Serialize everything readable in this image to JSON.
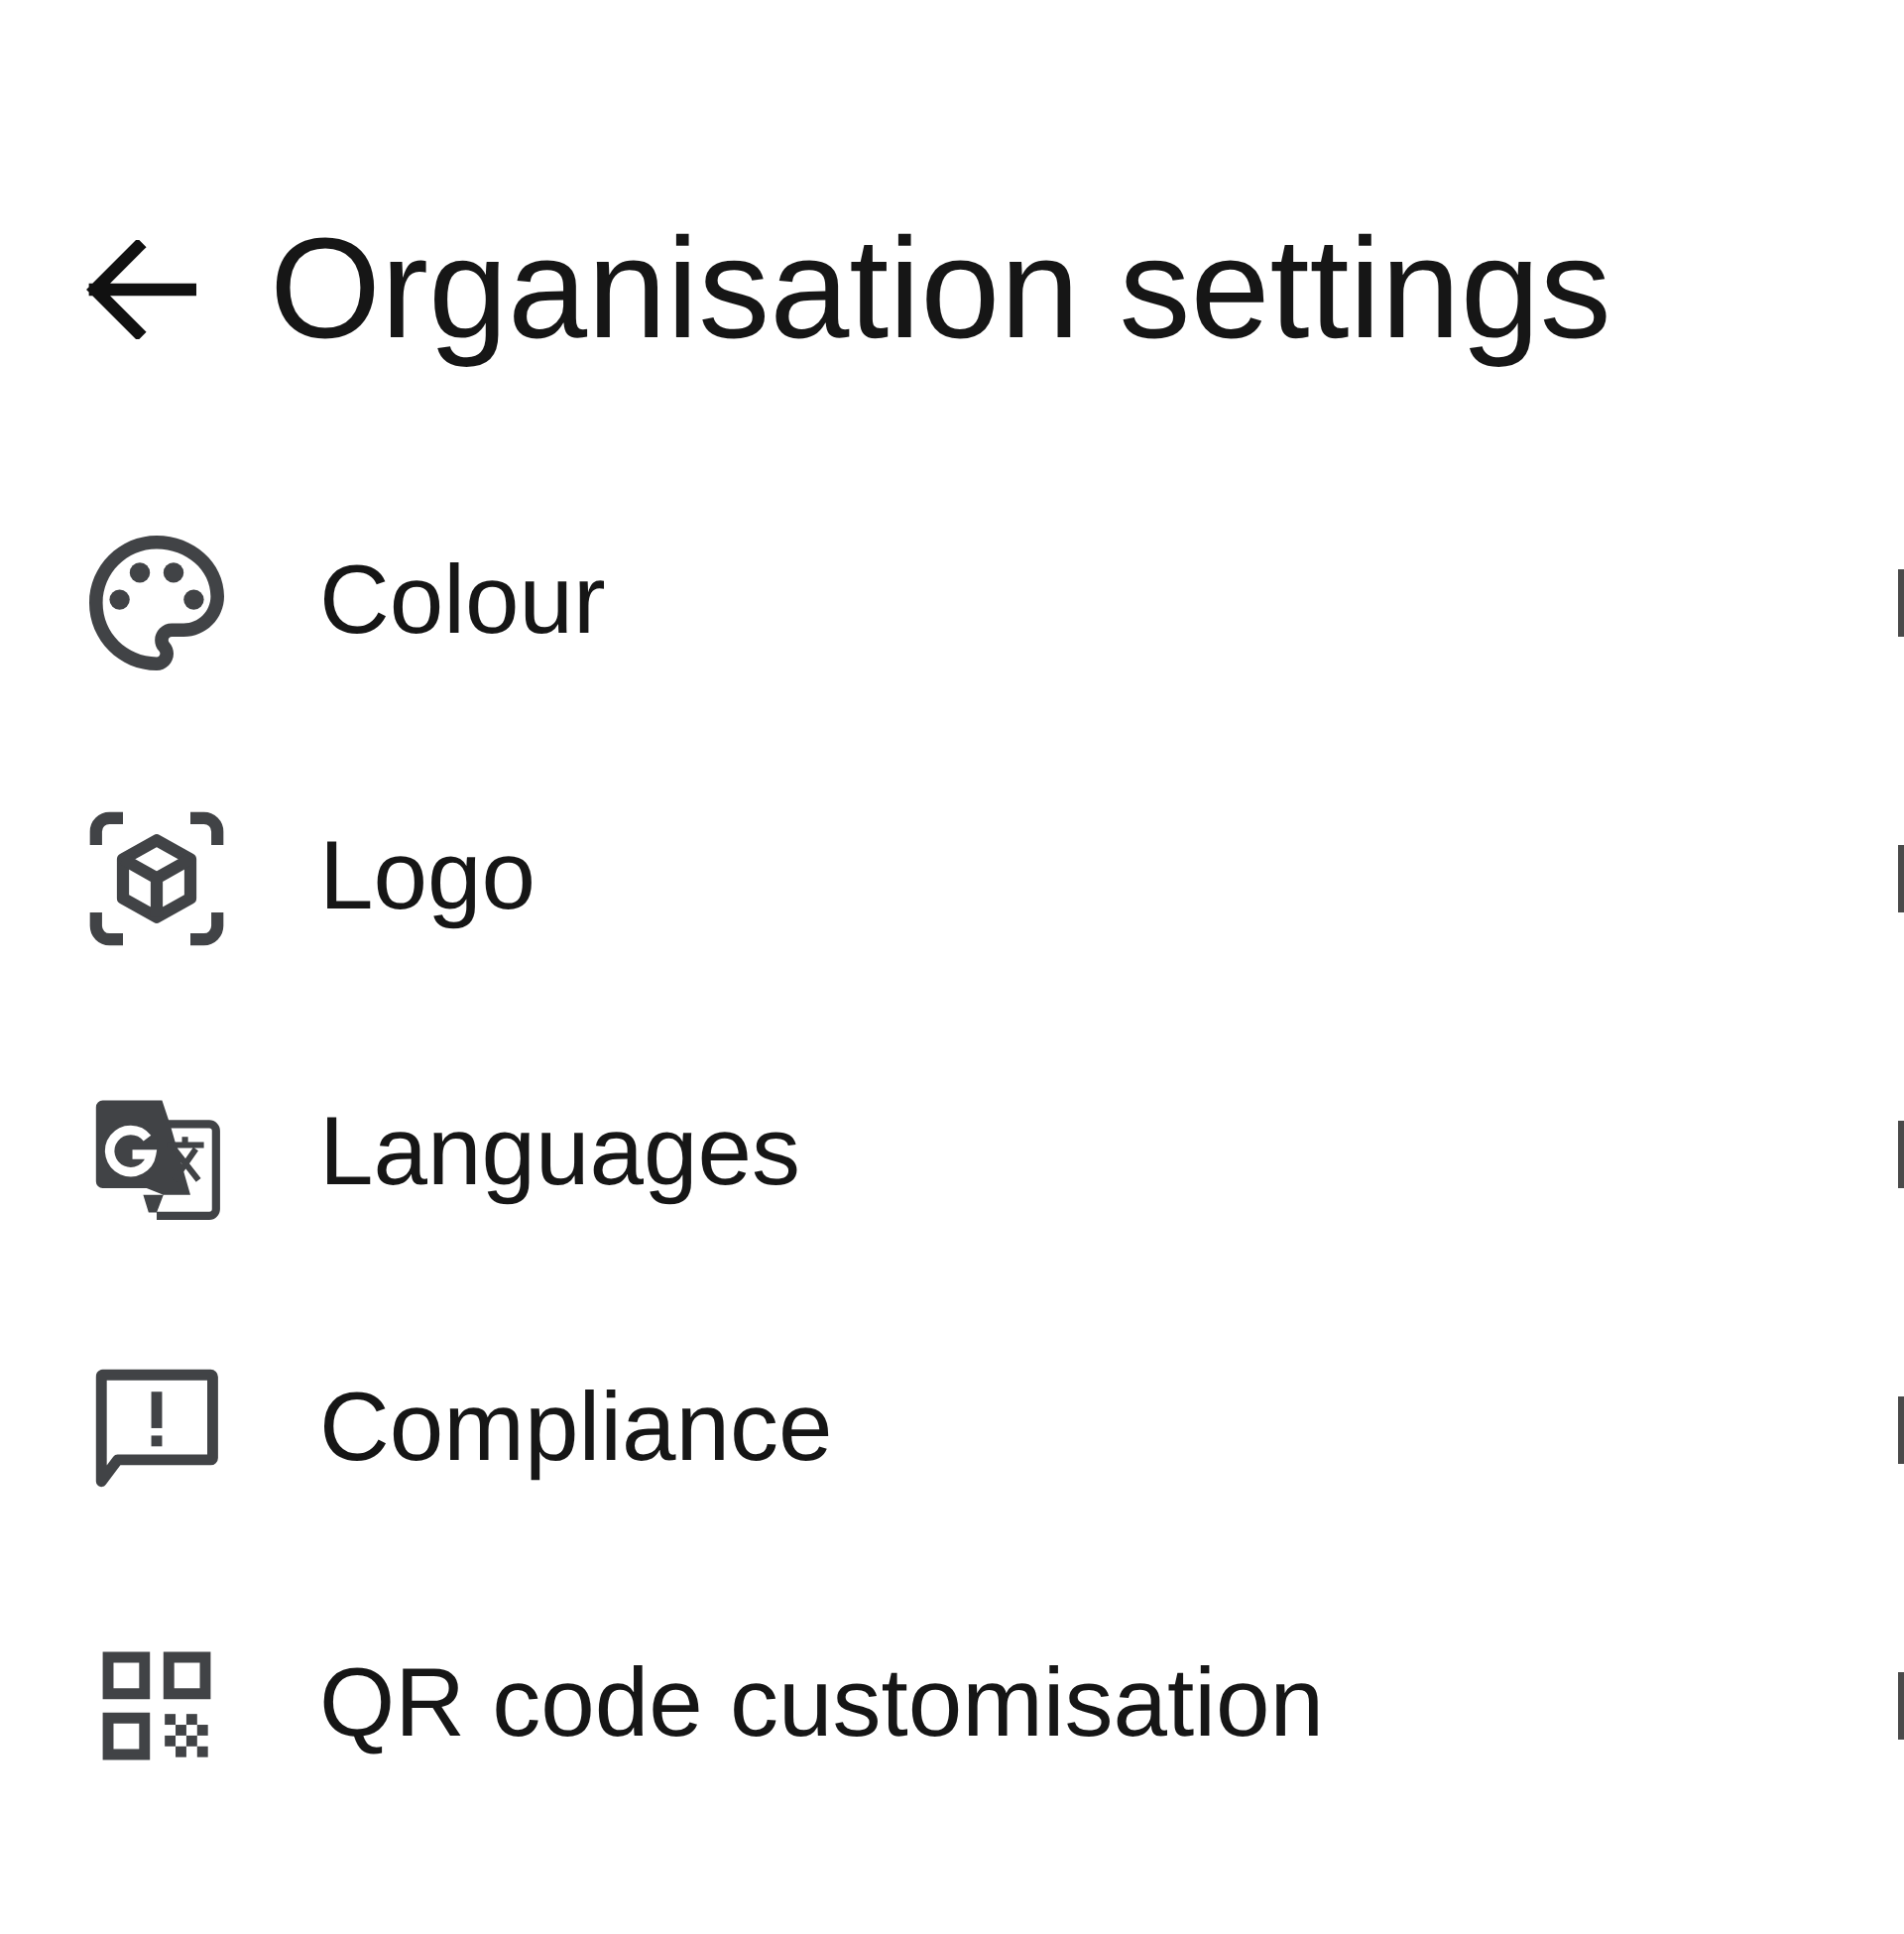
{
  "header": {
    "title": "Organisation settings"
  },
  "items": [
    {
      "label": "Colour",
      "kind": "palette"
    },
    {
      "label": "Logo",
      "kind": "cube"
    },
    {
      "label": "Languages",
      "kind": "translate"
    },
    {
      "label": "Compliance",
      "kind": "alert"
    },
    {
      "label": "QR code customisation",
      "kind": "qr"
    }
  ]
}
